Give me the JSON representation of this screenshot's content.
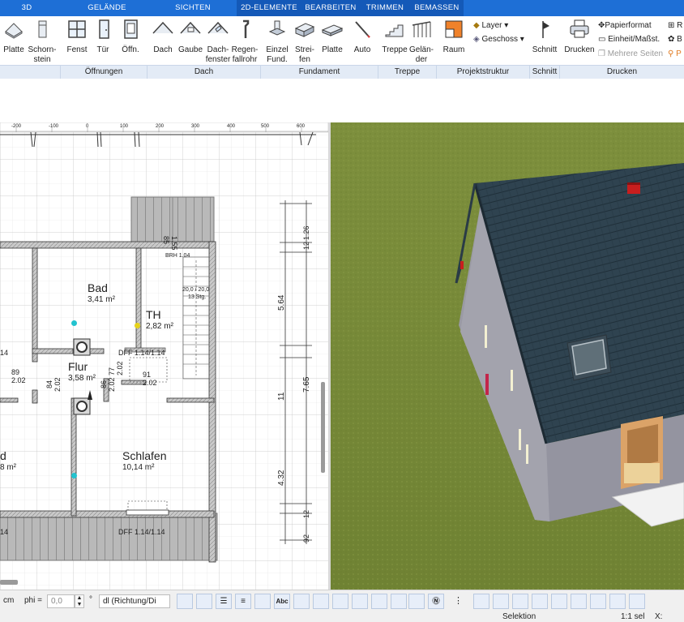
{
  "menu": {
    "tabs": [
      {
        "label": "3D"
      },
      {
        "label": "GELÄNDE"
      },
      {
        "label": "SICHTEN"
      },
      {
        "label": "2D-ELEMENTE"
      },
      {
        "label": "BEARBEITEN"
      },
      {
        "label": "TRIMMEN"
      },
      {
        "label": "BEMASSEN"
      }
    ]
  },
  "ribbon": {
    "buttons": [
      {
        "label": "Platte"
      },
      {
        "label": "Schorn-\nstein"
      },
      {
        "label": "Fenst"
      },
      {
        "label": "Tür"
      },
      {
        "label": "Öffn."
      },
      {
        "label": "Dach"
      },
      {
        "label": "Gaube"
      },
      {
        "label": "Dach-\nfenster"
      },
      {
        "label": "Regen-\nfallrohr"
      },
      {
        "label": "Einzel\nFund."
      },
      {
        "label": "Strei-\nfen"
      },
      {
        "label": "Platte"
      },
      {
        "label": "Auto"
      },
      {
        "label": "Treppe"
      },
      {
        "label": "Gelän-\nder"
      },
      {
        "label": "Raum"
      },
      {
        "label": "Schnitt"
      },
      {
        "label": "Drucken"
      }
    ],
    "layer_label": "Layer",
    "geschoss_label": "Geschoss",
    "papierformat_label": "Papierformat",
    "einheit_label": "Einheit/Maßst.",
    "mehrere_seiten_label": "Mehrere Seiten",
    "groups": [
      {
        "label": "Öffnungen"
      },
      {
        "label": "Dach"
      },
      {
        "label": "Fundament"
      },
      {
        "label": "Treppe"
      },
      {
        "label": "Projektstruktur"
      },
      {
        "label": "Schnitt"
      },
      {
        "label": "Drucken"
      }
    ]
  },
  "plan": {
    "ruler_ticks": [
      "-200",
      "-100",
      "0",
      "100",
      "200",
      "300",
      "400",
      "500",
      "600"
    ],
    "rooms": {
      "bad": {
        "name": "Bad",
        "area": "3,41 m²"
      },
      "th": {
        "name": "TH",
        "area": "2,82 m²"
      },
      "flur": {
        "name": "Flur",
        "area": "3,58 m²"
      },
      "schlafen": {
        "name": "Schlafen",
        "area": "10,14 m²"
      },
      "left_room": {
        "name": "d",
        "area": "8 m²"
      }
    },
    "labels": {
      "brh": "BRH 1.04",
      "stair": "20,0 / 20,0",
      "stair_steps": "13 Stg.",
      "dff_top": "DFF 1.14/1.14",
      "dff_bottom": "DFF 1.14/1.14",
      "left_14_top": "14",
      "left_14_bottom": "14",
      "door_89": "89",
      "door_89_h": "2.02",
      "door_84": "84",
      "door_84_h": "2.02",
      "door_86": "86",
      "door_86_h": "2.02",
      "door_77": "77",
      "door_77_h": "2.02",
      "door_91": "91",
      "door_91_h": "2.02",
      "dim_155": "1.55",
      "dim_85": "85",
      "dim_126": "1.26",
      "dim_12a": "12",
      "dim_564": "5.64",
      "dim_11": "11",
      "dim_765": "7.65",
      "dim_432": "4.32",
      "dim_12b": "12",
      "dim_92": "92"
    }
  },
  "toolbar": {
    "unit": "cm",
    "phi_label": "phi =",
    "phi_value": "0,0",
    "degree": "°",
    "direction_value": "dl (Richtung/Di"
  },
  "status": {
    "mode": "Selektion",
    "scale": "1:1 sel",
    "coord_label": "X:"
  },
  "colors": {
    "accent": "#1e6fd6",
    "roof": "#2f4350",
    "grass": "#7c8e3c",
    "wall": "#9898a2"
  }
}
